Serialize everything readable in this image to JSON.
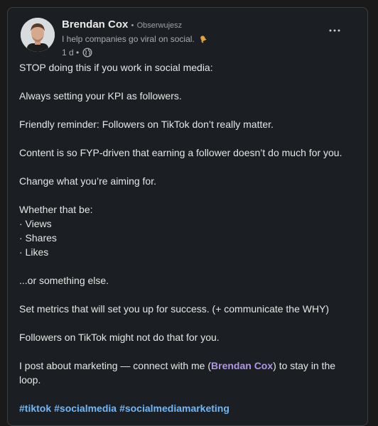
{
  "post": {
    "author_name": "Brendan Cox",
    "follow_separator": "•",
    "follow_status": "Obserwujesz",
    "headline": "I help companies go viral on social.",
    "time_ago": "1 d",
    "meta_separator": "•",
    "more_menu": "···",
    "lines": {
      "l1": "STOP doing this if you work in social media:",
      "l2": "Always setting your KPI as followers.",
      "l3": "Friendly reminder: Followers on TikTok don’t really matter.",
      "l4": "Content is so FYP-driven that earning a follower doesn’t do much for you.",
      "l5": "Change what you’re aiming for.",
      "l6": "Whether that be:",
      "l7": "· Views",
      "l8": "· Shares",
      "l9": "· Likes",
      "l10": "...or something else.",
      "l11": "Set metrics that will set you up for success. (+ communicate the WHY)",
      "l12": "Followers on TikTok might not do that for you.",
      "l13_prefix": "I post about marketing — connect with me (",
      "l13_mention": "Brendan Cox",
      "l13_suffix": ") to stay in the",
      "l14": "loop."
    },
    "hashtags": [
      "#tiktok",
      "#socialmedia",
      "#socialmediamarketing"
    ]
  },
  "icons": {
    "bell": "bell-icon",
    "globe": "globe-icon",
    "menu": "more-horizontal-icon"
  },
  "colors": {
    "background": "#1b1f23",
    "text": "#e6e6e6",
    "secondary_text": "#a8adb2",
    "mention": "#b195e8",
    "hashtag": "#71b7fb"
  }
}
